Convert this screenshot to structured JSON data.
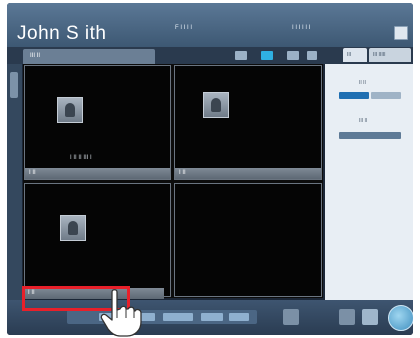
{
  "header": {
    "patient_name": "John S  ith",
    "info_mid_1": "F  I  I  I I",
    "info_mid_2": "",
    "info_right_1": "I  I I  I  I I",
    "info_right_2": ""
  },
  "tabs": {
    "main_label": "III  II",
    "side_1": "III",
    "side_2": "III  IIIII"
  },
  "viewer": {
    "cells": [
      {
        "caption": "I  II II  III  I",
        "foot": "I II"
      },
      {
        "caption": "",
        "foot": "I II"
      },
      {
        "caption": "",
        "foot": ""
      },
      {
        "caption": "",
        "foot": ""
      }
    ],
    "bottom_left_foot": "I II"
  },
  "right_panel": {
    "label_1": "II II",
    "label_2": "III II"
  },
  "colors": {
    "accent": "#2fb1e3",
    "highlight": "#e8202a"
  },
  "icons": [
    "pointing-hand-icon",
    "settings-icon",
    "grid-icon",
    "exit-icon"
  ]
}
